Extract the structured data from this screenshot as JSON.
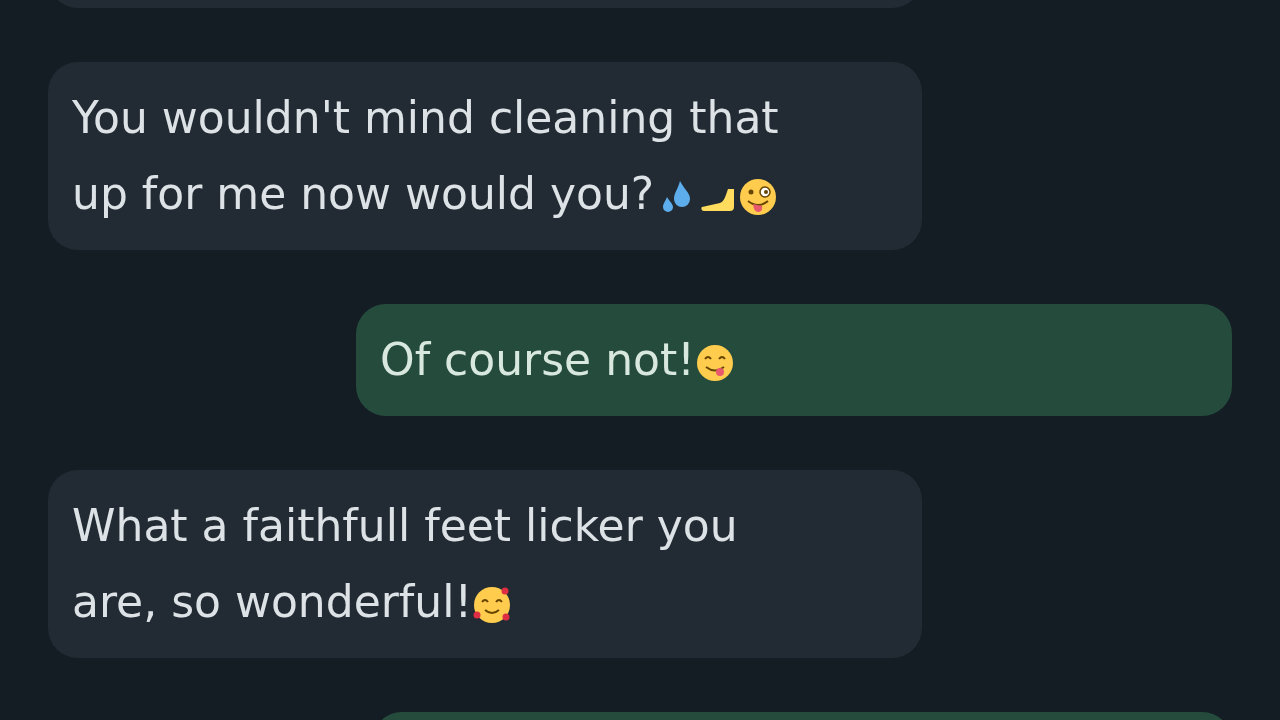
{
  "messages": [
    {
      "kind": "incoming"
    },
    {
      "kind": "incoming",
      "text": "You wouldn't mind cleaning that up for me now would you?"
    },
    {
      "kind": "outgoing",
      "text": "Of course not!"
    },
    {
      "kind": "incoming",
      "text": "What a faithfull feet licker you are, so wonderful!"
    },
    {
      "kind": "outgoing"
    }
  ]
}
